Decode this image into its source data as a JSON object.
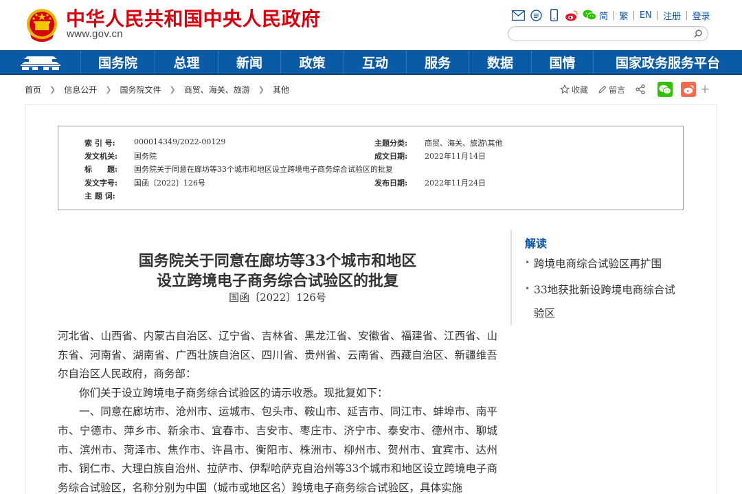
{
  "header": {
    "site_title": "中华人民共和国中央人民政府",
    "site_url": "www.gov.cn",
    "links": [
      "简",
      "繁",
      "EN",
      "注册",
      "登录"
    ],
    "search_placeholder": ""
  },
  "nav": {
    "items": [
      "国务院",
      "总理",
      "新闻",
      "政策",
      "互动",
      "服务",
      "数据",
      "国情",
      "国家政务服务平台"
    ]
  },
  "breadcrumb": [
    "首页",
    "信息公开",
    "国务院文件",
    "商贸、海关、旅游",
    "其他"
  ],
  "tools": {
    "favorite_label": "收藏",
    "comment_label": "留言"
  },
  "meta": {
    "index_label": "索 引 号:",
    "index_value": "000014349/2022-00129",
    "topic_label": "主题分类:",
    "topic_value": "商贸、海关、旅游\\其他",
    "issuer_label": "发文机关:",
    "issuer_value": "国务院",
    "created_label": "成文日期:",
    "created_value": "2022年11月14日",
    "title_label": "标　　题:",
    "title_value": "国务院关于同意在廊坊等33个城市和地区设立跨境电子商务综合试验区的批复",
    "doc_no_label": "发文字号:",
    "doc_no_value": "国函〔2022〕126号",
    "published_label": "发布日期:",
    "published_value": "2022年11月24日",
    "keywords_label": "主 题 词:"
  },
  "document": {
    "title_line1": "国务院关于同意在廊坊等33个城市和地区",
    "title_line2": "设立跨境电子商务综合试验区的批复",
    "number": "国函〔2022〕126号",
    "recipients": "河北省、山西省、内蒙古自治区、辽宁省、吉林省、黑龙江省、安徽省、福建省、江西省、山东省、河南省、湖南省、广西壮族自治区、四川省、贵州省、云南省、西藏自治区、新疆维吾尔自治区人民政府，商务部：",
    "para1": "你们关于设立跨境电子商务综合试验区的请示收悉。现批复如下：",
    "para2": "一、同意在廊坊市、沧州市、运城市、包头市、鞍山市、延吉市、同江市、蚌埠市、南平市、宁德市、萍乡市、新余市、宜春市、吉安市、枣庄市、济宁市、泰安市、德州市、聊城市、滨州市、菏泽市、焦作市、许昌市、衡阳市、株洲市、柳州市、贺州市、宜宾市、达州市、铜仁市、大理白族自治州、拉萨市、伊犁哈萨克自治州等33个城市和地区设立跨境电子商务综合试验区，名称分别为中国（城市或地区名）跨境电子商务综合试验区，具体实施"
  },
  "sidebar": {
    "title": "解读",
    "items": [
      "跨境电商综合试验区再扩围",
      "33地获批新设跨境电商综合试验区"
    ]
  },
  "colors": {
    "brand_red": "#d7000f",
    "nav_blue": "#0b5aa6",
    "link_blue": "#0b56a5",
    "wechat_green": "#2dc100",
    "weibo_red": "#f06b4e"
  }
}
